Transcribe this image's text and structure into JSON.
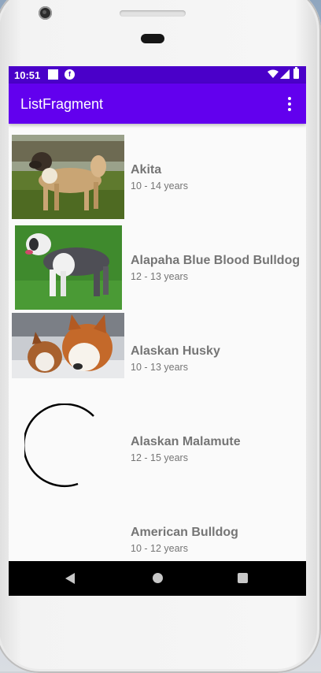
{
  "status_bar": {
    "time": "10:51",
    "icons": [
      "stop-square-icon",
      "notification-f-icon",
      "wifi-icon",
      "signal-icon",
      "battery-icon"
    ]
  },
  "app_bar": {
    "title": "ListFragment",
    "menu_icon": "overflow-menu-icon",
    "color": "#6200ee",
    "status_color": "#4a00c9"
  },
  "list": {
    "items": [
      {
        "name": "Akita",
        "years": "10 - 14 years",
        "image": "akita-photo"
      },
      {
        "name": "Alapaha Blue Blood Bulldog",
        "years": "12 - 13 years",
        "image": "alapaha-bulldog-photo"
      },
      {
        "name": "Alaskan Husky",
        "years": "10 - 13 years",
        "image": "alaskan-husky-photo"
      },
      {
        "name": "Alaskan Malamute",
        "years": "12 - 15 years",
        "image": "loading-spinner"
      },
      {
        "name": "American Bulldog",
        "years": "10 - 12 years",
        "image": ""
      }
    ],
    "text_color": "#757575"
  },
  "nav_bar": {
    "buttons": [
      "back-icon",
      "home-icon",
      "recents-icon"
    ]
  }
}
